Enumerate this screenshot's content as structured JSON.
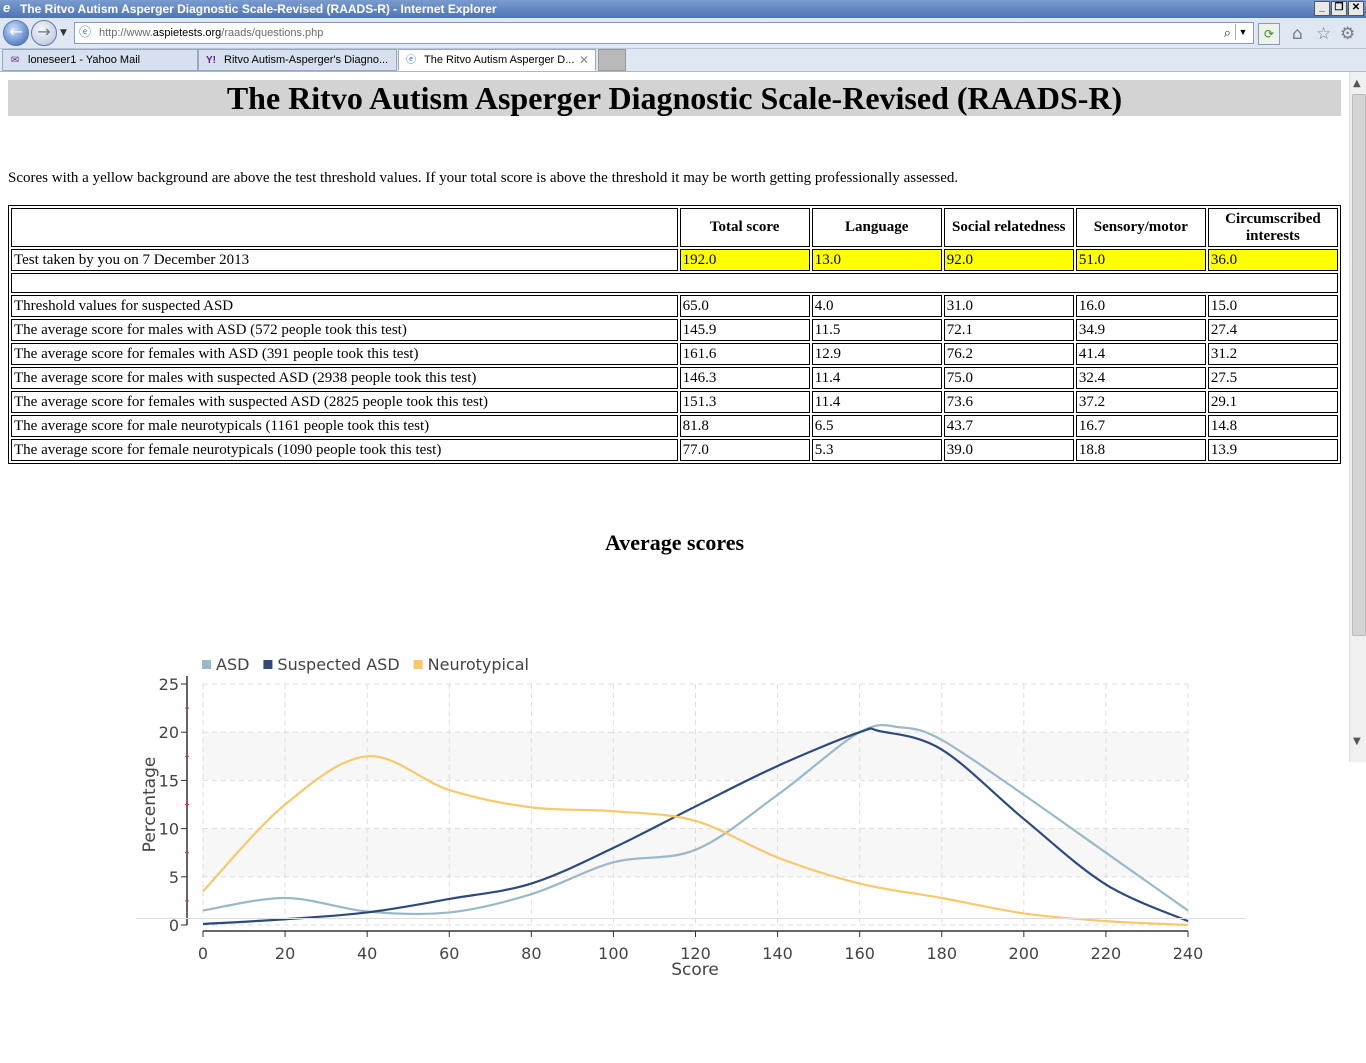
{
  "window": {
    "title": "The Ritvo Autism Asperger Diagnostic Scale-Revised (RAADS-R) - Internet Explorer"
  },
  "address": {
    "url_prefix": "http://www.",
    "url_domain": "aspietests.org",
    "url_path": "/raads/questions.php"
  },
  "tabs": [
    {
      "label": "loneseer1 - Yahoo Mail",
      "icon": "mail-icon"
    },
    {
      "label": "Ritvo Autism-Asperger's Diagno...",
      "icon": "yahoo-icon"
    },
    {
      "label": "The Ritvo Autism Asperger D...",
      "icon": "ie-page-icon",
      "active": true
    }
  ],
  "page": {
    "heading": "The Ritvo Autism Asperger Diagnostic Scale-Revised (RAADS-R)",
    "intro": "Scores with a yellow background are above the test threshold values. If your total score is above the threshold it may be worth getting professionally assessed.",
    "table": {
      "headers": [
        "",
        "Total score",
        "Language",
        "Social relatedness",
        "Sensory/motor",
        "Circumscribed interests"
      ],
      "user_row": {
        "label": "Test taken by you on 7 December 2013",
        "values": [
          "192.0",
          "13.0",
          "92.0",
          "51.0",
          "36.0"
        ]
      },
      "rows": [
        {
          "label": "Threshold values for suspected ASD",
          "values": [
            "65.0",
            "4.0",
            "31.0",
            "16.0",
            "15.0"
          ]
        },
        {
          "label": "The average score for males with ASD (572 people took this test)",
          "values": [
            "145.9",
            "11.5",
            "72.1",
            "34.9",
            "27.4"
          ]
        },
        {
          "label": "The average score for females with ASD (391 people took this test)",
          "values": [
            "161.6",
            "12.9",
            "76.2",
            "41.4",
            "31.2"
          ]
        },
        {
          "label": "The average score for males with suspected ASD (2938 people took this test)",
          "values": [
            "146.3",
            "11.4",
            "75.0",
            "32.4",
            "27.5"
          ]
        },
        {
          "label": "The average score for females with suspected ASD (2825 people took this test)",
          "values": [
            "151.3",
            "11.4",
            "73.6",
            "37.2",
            "29.1"
          ]
        },
        {
          "label": "The average score for male neurotypicals (1161 people took this test)",
          "values": [
            "81.8",
            "6.5",
            "43.7",
            "16.7",
            "14.8"
          ]
        },
        {
          "label": "The average score for female neurotypicals (1090 people took this test)",
          "values": [
            "77.0",
            "5.3",
            "39.0",
            "18.8",
            "13.9"
          ]
        }
      ],
      "highlight_color": "#ffff00"
    },
    "chart_title": "Average scores"
  },
  "chart_data": {
    "type": "line",
    "title": "Average scores",
    "xlabel": "Score",
    "ylabel": "Percentage",
    "xlim": [
      0,
      240
    ],
    "ylim": [
      0,
      25
    ],
    "x_ticks": [
      0,
      20,
      40,
      60,
      80,
      100,
      120,
      140,
      160,
      180,
      200,
      220,
      240
    ],
    "y_ticks": [
      0,
      5,
      10,
      15,
      20,
      25
    ],
    "grid": true,
    "legend_position": "top-left",
    "series": [
      {
        "name": "ASD",
        "color": "#9bb8c8",
        "x": [
          0,
          20,
          40,
          60,
          80,
          100,
          120,
          140,
          160,
          170,
          180,
          200,
          220,
          240
        ],
        "y": [
          1.5,
          2.8,
          1.4,
          1.3,
          3.2,
          6.5,
          7.8,
          13.5,
          20.0,
          20.5,
          19.2,
          13.5,
          7.5,
          1.5
        ]
      },
      {
        "name": "Suspected ASD",
        "color": "#2e4a7a",
        "x": [
          0,
          20,
          40,
          60,
          80,
          100,
          120,
          140,
          160,
          165,
          180,
          200,
          220,
          240
        ],
        "y": [
          0.1,
          0.6,
          1.3,
          2.7,
          4.3,
          8.0,
          12.3,
          16.5,
          20.0,
          20.1,
          18.2,
          11.0,
          4.2,
          0.4
        ]
      },
      {
        "name": "Neurotypical",
        "color": "#f7c96a",
        "x": [
          0,
          20,
          40,
          60,
          80,
          100,
          120,
          140,
          160,
          180,
          200,
          220,
          240
        ],
        "y": [
          3.5,
          12.5,
          17.5,
          14.0,
          12.2,
          11.8,
          10.8,
          7.0,
          4.3,
          2.8,
          1.2,
          0.4,
          0.0
        ]
      }
    ]
  }
}
